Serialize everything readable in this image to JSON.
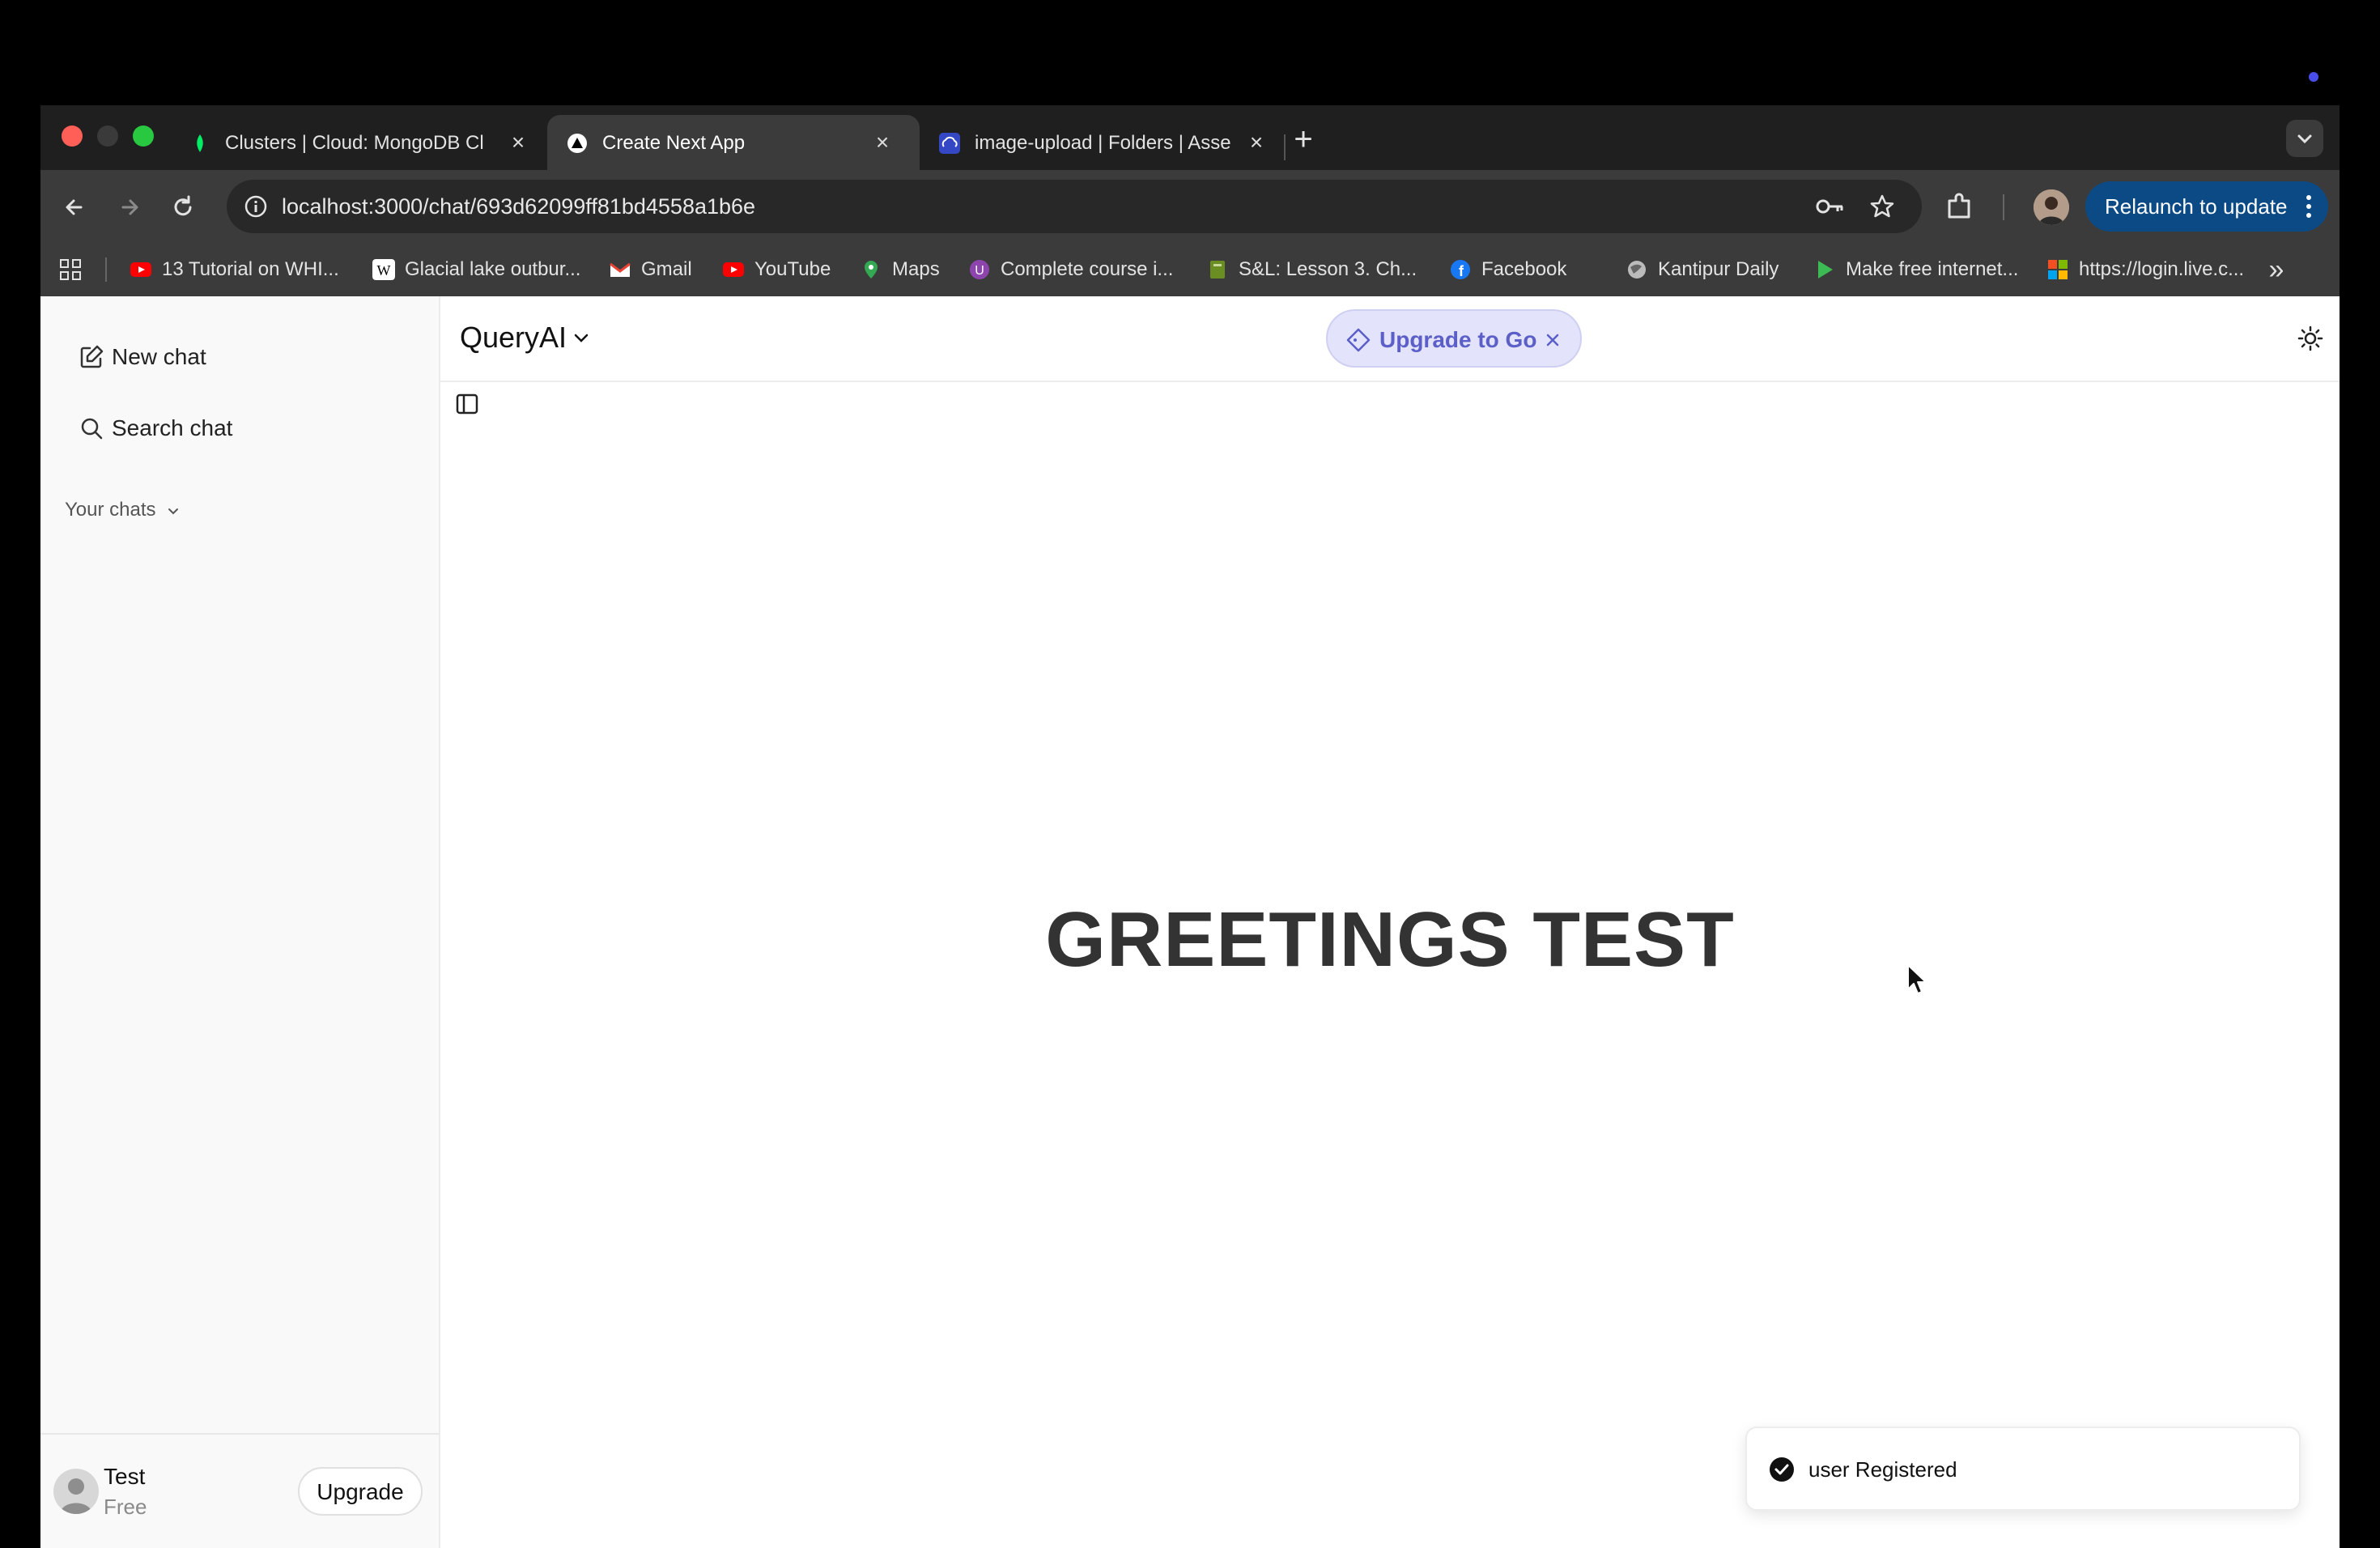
{
  "browser": {
    "tabs": [
      {
        "title": "Clusters | Cloud: MongoDB Cl",
        "favicon": "mongodb-leaf-icon",
        "active": false
      },
      {
        "title": "Create Next App",
        "favicon": "vercel-triangle-icon",
        "active": true
      },
      {
        "title": "image-upload | Folders | Asse",
        "favicon": "cloudinary-icon",
        "active": false
      }
    ],
    "new_tab_label": "+",
    "url": "localhost:3000/chat/693d62099ff81bd4558a1b6e",
    "relaunch_label": "Relaunch to update",
    "bookmarks": [
      {
        "label": "13 Tutorial on WHI...",
        "icon": "youtube-icon",
        "color": "#ff0000"
      },
      {
        "label": "Glacial lake outbur...",
        "icon": "wikipedia-icon",
        "color": "#ffffff"
      },
      {
        "label": "Gmail",
        "icon": "gmail-icon",
        "color": "#ea4335"
      },
      {
        "label": "YouTube",
        "icon": "youtube-icon",
        "color": "#ff0000"
      },
      {
        "label": "Maps",
        "icon": "maps-pin-icon",
        "color": "#34a853"
      },
      {
        "label": "Complete course i...",
        "icon": "course-icon",
        "color": "#8e44ad"
      },
      {
        "label": "S&L: Lesson 3. Ch...",
        "icon": "book-icon",
        "color": "#6b8e23"
      },
      {
        "label": "Facebook",
        "icon": "facebook-icon",
        "color": "#1877f2"
      },
      {
        "label": "Kantipur Daily",
        "icon": "globe-icon",
        "color": "#bbbbbb"
      },
      {
        "label": "Make free internet...",
        "icon": "play-icon",
        "color": "#3cba54"
      },
      {
        "label": "https://login.live.c...",
        "icon": "microsoft-icon",
        "color": "#f25022"
      }
    ],
    "bookmarks_overflow": "»"
  },
  "sidebar": {
    "new_chat_label": "New chat",
    "search_label": "Search chat",
    "section_label": "Your chats",
    "user": {
      "name": "Test",
      "plan": "Free",
      "upgrade_label": "Upgrade"
    }
  },
  "header": {
    "model_name": "QueryAI",
    "upgrade_pill_label": "Upgrade to Go"
  },
  "main": {
    "greeting": "GREETINGS TEST"
  },
  "toast": {
    "message": "user Registered"
  },
  "colors": {
    "accent": "#5b5fc7",
    "relaunch": "#0c4a86",
    "tab_active": "#3b3b3b"
  }
}
